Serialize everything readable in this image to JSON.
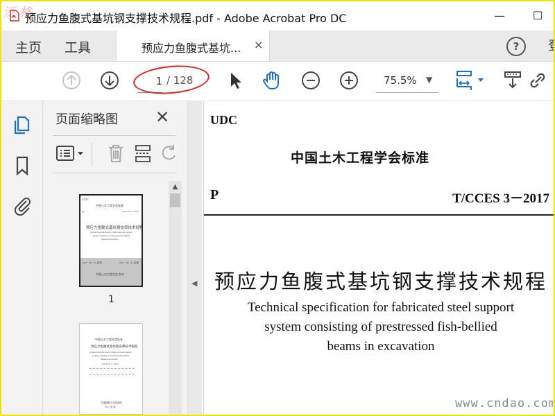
{
  "window": {
    "title": "预应力鱼腹式基坑钢支撑技术规程.pdf - Adobe Acrobat Pro DC",
    "minimize": "—",
    "maximize": "☐"
  },
  "menubar": {
    "home": "主页",
    "tools": "工具",
    "doc_tab": "预应力鱼腹式基坑...",
    "tab_close": "×",
    "help": "?",
    "cut_item": "登"
  },
  "toolbar": {
    "page_current": "1",
    "page_total": "/ 128",
    "zoom": "75.5%",
    "zoom_arrow": "▼"
  },
  "thumb_panel": {
    "title": "页面缩略图",
    "close": "✕",
    "scroll_up": "▲",
    "thumbs": [
      {
        "label": "1"
      }
    ]
  },
  "thumb1": {
    "udc": "UDC",
    "society": "中国土木工程学会标准",
    "p": "P",
    "code": "T/CCES 3 - 2017",
    "title": "预应力鱼腹式基坑钢支撑技术规程",
    "en1": "Technical specification for fabricated steel support",
    "en2": "system consisting of prestressed fish-bellied",
    "en3": "beams in excavation",
    "date_left": "2017 - 09 - 05   发布",
    "date_right": "2017 - 09 - 20   实施",
    "publisher": "中国土木工程学会   发布"
  },
  "thumb2": {
    "society": "中国土木工程学会标准",
    "title": "预应力鱼腹式基坑钢支撑技术规程",
    "en1": "Technical specification for fabricated steel support",
    "en2": "system consisting of prestressed fish-bellied",
    "en3": "beams in excavation",
    "code": "T/CCES 3 - 2017",
    "press": "中国建筑工业出版社",
    "year": "2017   北   京"
  },
  "collapse": "◀",
  "document": {
    "udc": "UDC",
    "society": "中国土木工程学会标准",
    "p": "P",
    "code": "T/CCES 3－2017",
    "title": "预应力鱼腹式基坑钢支撑技术规程",
    "en_line1": "Technical specification for fabricated steel support",
    "en_line2": "system consisting of prestressed fish-bellied",
    "en_line3": "beams in excavation"
  },
  "watermarks": {
    "top_left": "泛 格",
    "bottom_right": "www.cndao.com"
  },
  "colors": {
    "frame": "#f1e20d",
    "annotation": "#d82424",
    "accent": "#1f6fc5"
  }
}
